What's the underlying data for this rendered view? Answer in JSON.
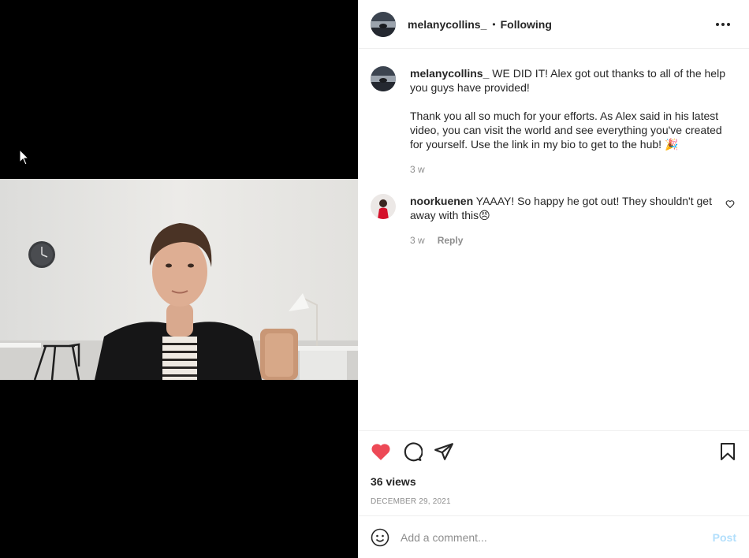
{
  "post": {
    "author": "melanycollins_",
    "separator": "•",
    "follow_status": "Following"
  },
  "caption": {
    "author": "melanycollins_",
    "line1": "WE DID IT! Alex got out thanks to all of the help you guys have provided!",
    "line2": "Thank you all so much for your efforts. As Alex said in his latest video, you can visit the world and see everything you've created for yourself. Use the link in my bio to get to the hub! 🎉",
    "age": "3 w"
  },
  "comments": [
    {
      "author": "noorkuenen",
      "text": "YAAAY! So happy he got out! They shouldn't get away with this😠",
      "age": "3 w",
      "reply_label": "Reply"
    }
  ],
  "stats": {
    "views": "36 views",
    "date": "DECEMBER 29, 2021"
  },
  "add_comment": {
    "placeholder": "Add a comment...",
    "post_label": "Post"
  },
  "colors": {
    "like_red": "#ed4956",
    "post_blue": "#b2dffc"
  },
  "icons": {
    "like": "heart-icon",
    "comment": "comment-icon",
    "share": "share-icon",
    "save": "bookmark-icon",
    "emoji": "emoji-icon",
    "more": "more-options-icon"
  }
}
